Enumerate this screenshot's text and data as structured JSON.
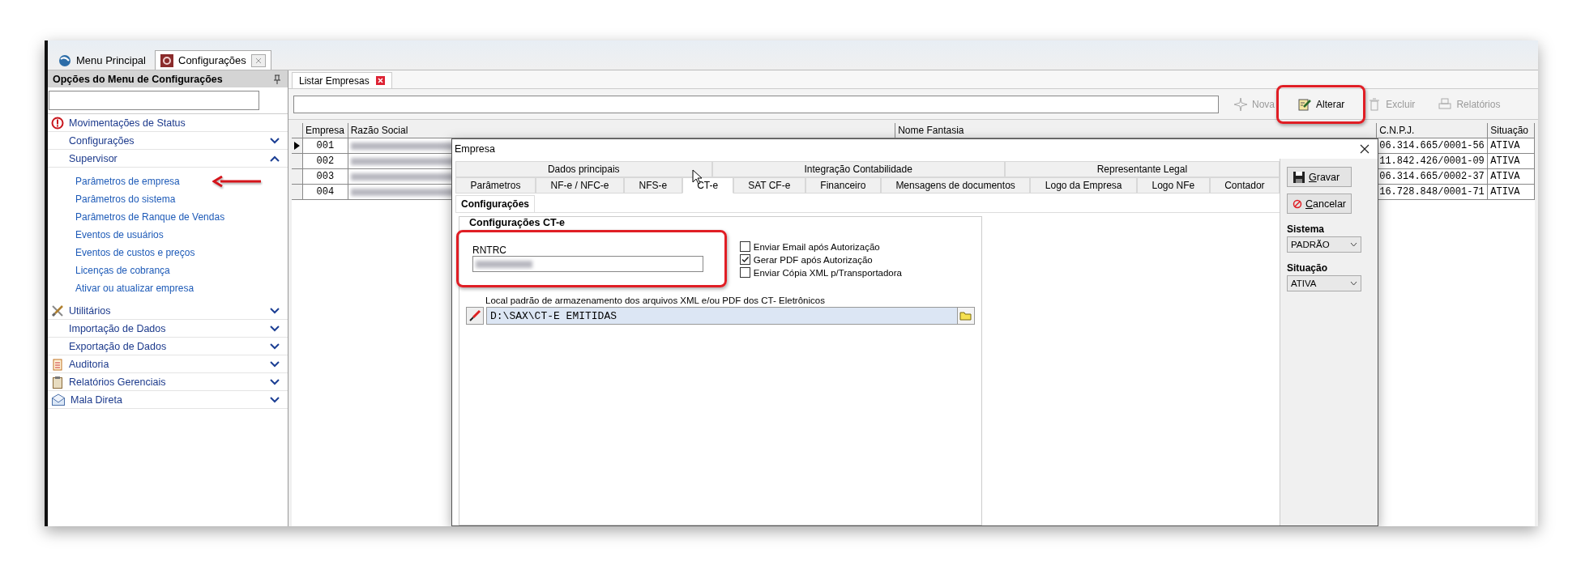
{
  "app_tabs": [
    {
      "label": "Menu Principal",
      "selected": false,
      "closable": false
    },
    {
      "label": "Configurações",
      "selected": true,
      "closable": true
    }
  ],
  "sidebar": {
    "title": "Opções do Menu de Configurações",
    "items": [
      {
        "label": "Movimentações de Status",
        "kind": "link"
      },
      {
        "label": "Configurações",
        "kind": "group",
        "expanded": false
      },
      {
        "label": "Supervisor",
        "kind": "group",
        "expanded": true,
        "children": [
          {
            "label": "Parâmetros de empresa",
            "pointed": true
          },
          {
            "label": "Parâmetros do sistema",
            "pointed": false
          },
          {
            "label": "Parâmetros de Ranque de Vendas",
            "pointed": false
          },
          {
            "label": "Eventos de usuários",
            "pointed": false
          },
          {
            "label": "Eventos de custos e preços",
            "pointed": false
          },
          {
            "label": "Licenças de cobrança",
            "pointed": false
          },
          {
            "label": "Ativar ou atualizar empresa",
            "pointed": false
          }
        ]
      },
      {
        "label": "Utilitários",
        "kind": "group",
        "expanded": false
      },
      {
        "label": "Importação de Dados",
        "kind": "group",
        "expanded": false
      },
      {
        "label": "Exportação de Dados",
        "kind": "group",
        "expanded": false
      },
      {
        "label": "Auditoria",
        "kind": "group",
        "expanded": false
      },
      {
        "label": "Relatórios Gerenciais",
        "kind": "group",
        "expanded": false
      },
      {
        "label": "Mala Direta",
        "kind": "group",
        "expanded": false
      }
    ]
  },
  "main_tabs": [
    {
      "label": "Listar Empresas",
      "selected": true,
      "closable": true
    }
  ],
  "toolbar": {
    "buttons": [
      {
        "label": "Nova",
        "disabled": true,
        "highlighted": false
      },
      {
        "label": "Alterar",
        "disabled": false,
        "highlighted": true
      },
      {
        "label": "Excluir",
        "disabled": true,
        "highlighted": false
      },
      {
        "label": "Relatórios",
        "disabled": true,
        "highlighted": false
      }
    ]
  },
  "table": {
    "columns": [
      "Empresa",
      "Razão Social",
      "Nome Fantasia",
      "C.N.P.J.",
      "Situação"
    ],
    "rows": [
      {
        "empresa": "001",
        "cnpj": "06.314.665/0001-56",
        "situacao": "ATIVA",
        "selected": true
      },
      {
        "empresa": "002",
        "cnpj": "11.842.426/0001-09",
        "situacao": "ATIVA",
        "selected": false
      },
      {
        "empresa": "003",
        "cnpj": "06.314.665/0002-37",
        "situacao": "ATIVA",
        "selected": false
      },
      {
        "empresa": "004",
        "cnpj": "16.728.848/0001-71",
        "situacao": "ATIVA",
        "selected": false
      }
    ]
  },
  "dialog": {
    "title": "Empresa",
    "tab_rows": [
      [
        {
          "label": "Dados principais",
          "selected": false
        },
        {
          "label": "Integração Contabilidade",
          "selected": false
        },
        {
          "label": "Representante Legal",
          "selected": false
        }
      ],
      [
        {
          "label": "Parâmetros",
          "selected": false
        },
        {
          "label": "NF-e / NFC-e",
          "selected": false
        },
        {
          "label": "NFS-e",
          "selected": false
        },
        {
          "label": "CT-e",
          "selected": true
        },
        {
          "label": "SAT CF-e",
          "selected": false
        },
        {
          "label": "Financeiro",
          "selected": false
        },
        {
          "label": "Mensagens de documentos",
          "selected": false
        },
        {
          "label": "Logo da Empresa",
          "selected": false
        },
        {
          "label": "Logo NFe",
          "selected": false
        },
        {
          "label": "Contador",
          "selected": false
        }
      ]
    ],
    "sub_tabs": [
      {
        "label": "Configurações",
        "selected": true
      }
    ],
    "group_title": "Configurações CT-e",
    "rntrc": {
      "label": "RNTRC",
      "highlighted": true
    },
    "checkboxes": [
      {
        "label": "Enviar Email após Autorização",
        "checked": false
      },
      {
        "label": "Gerar PDF após Autorização",
        "checked": true
      },
      {
        "label": "Enviar Cópia XML p/Transportadora",
        "checked": false
      }
    ],
    "path": {
      "label": "Local padrão de armazenamento dos arquivos XML e/ou PDF dos CT- Eletrônicos",
      "value": "D:\\SAX\\CT-E EMITIDAS"
    },
    "actions": [
      {
        "label": "Gravar",
        "kind": "save"
      },
      {
        "label": "Cancelar",
        "kind": "cancel"
      }
    ],
    "selects": [
      {
        "label": "Sistema",
        "value": "PADRÃO"
      },
      {
        "label": "Situação",
        "value": "ATIVA"
      }
    ]
  }
}
